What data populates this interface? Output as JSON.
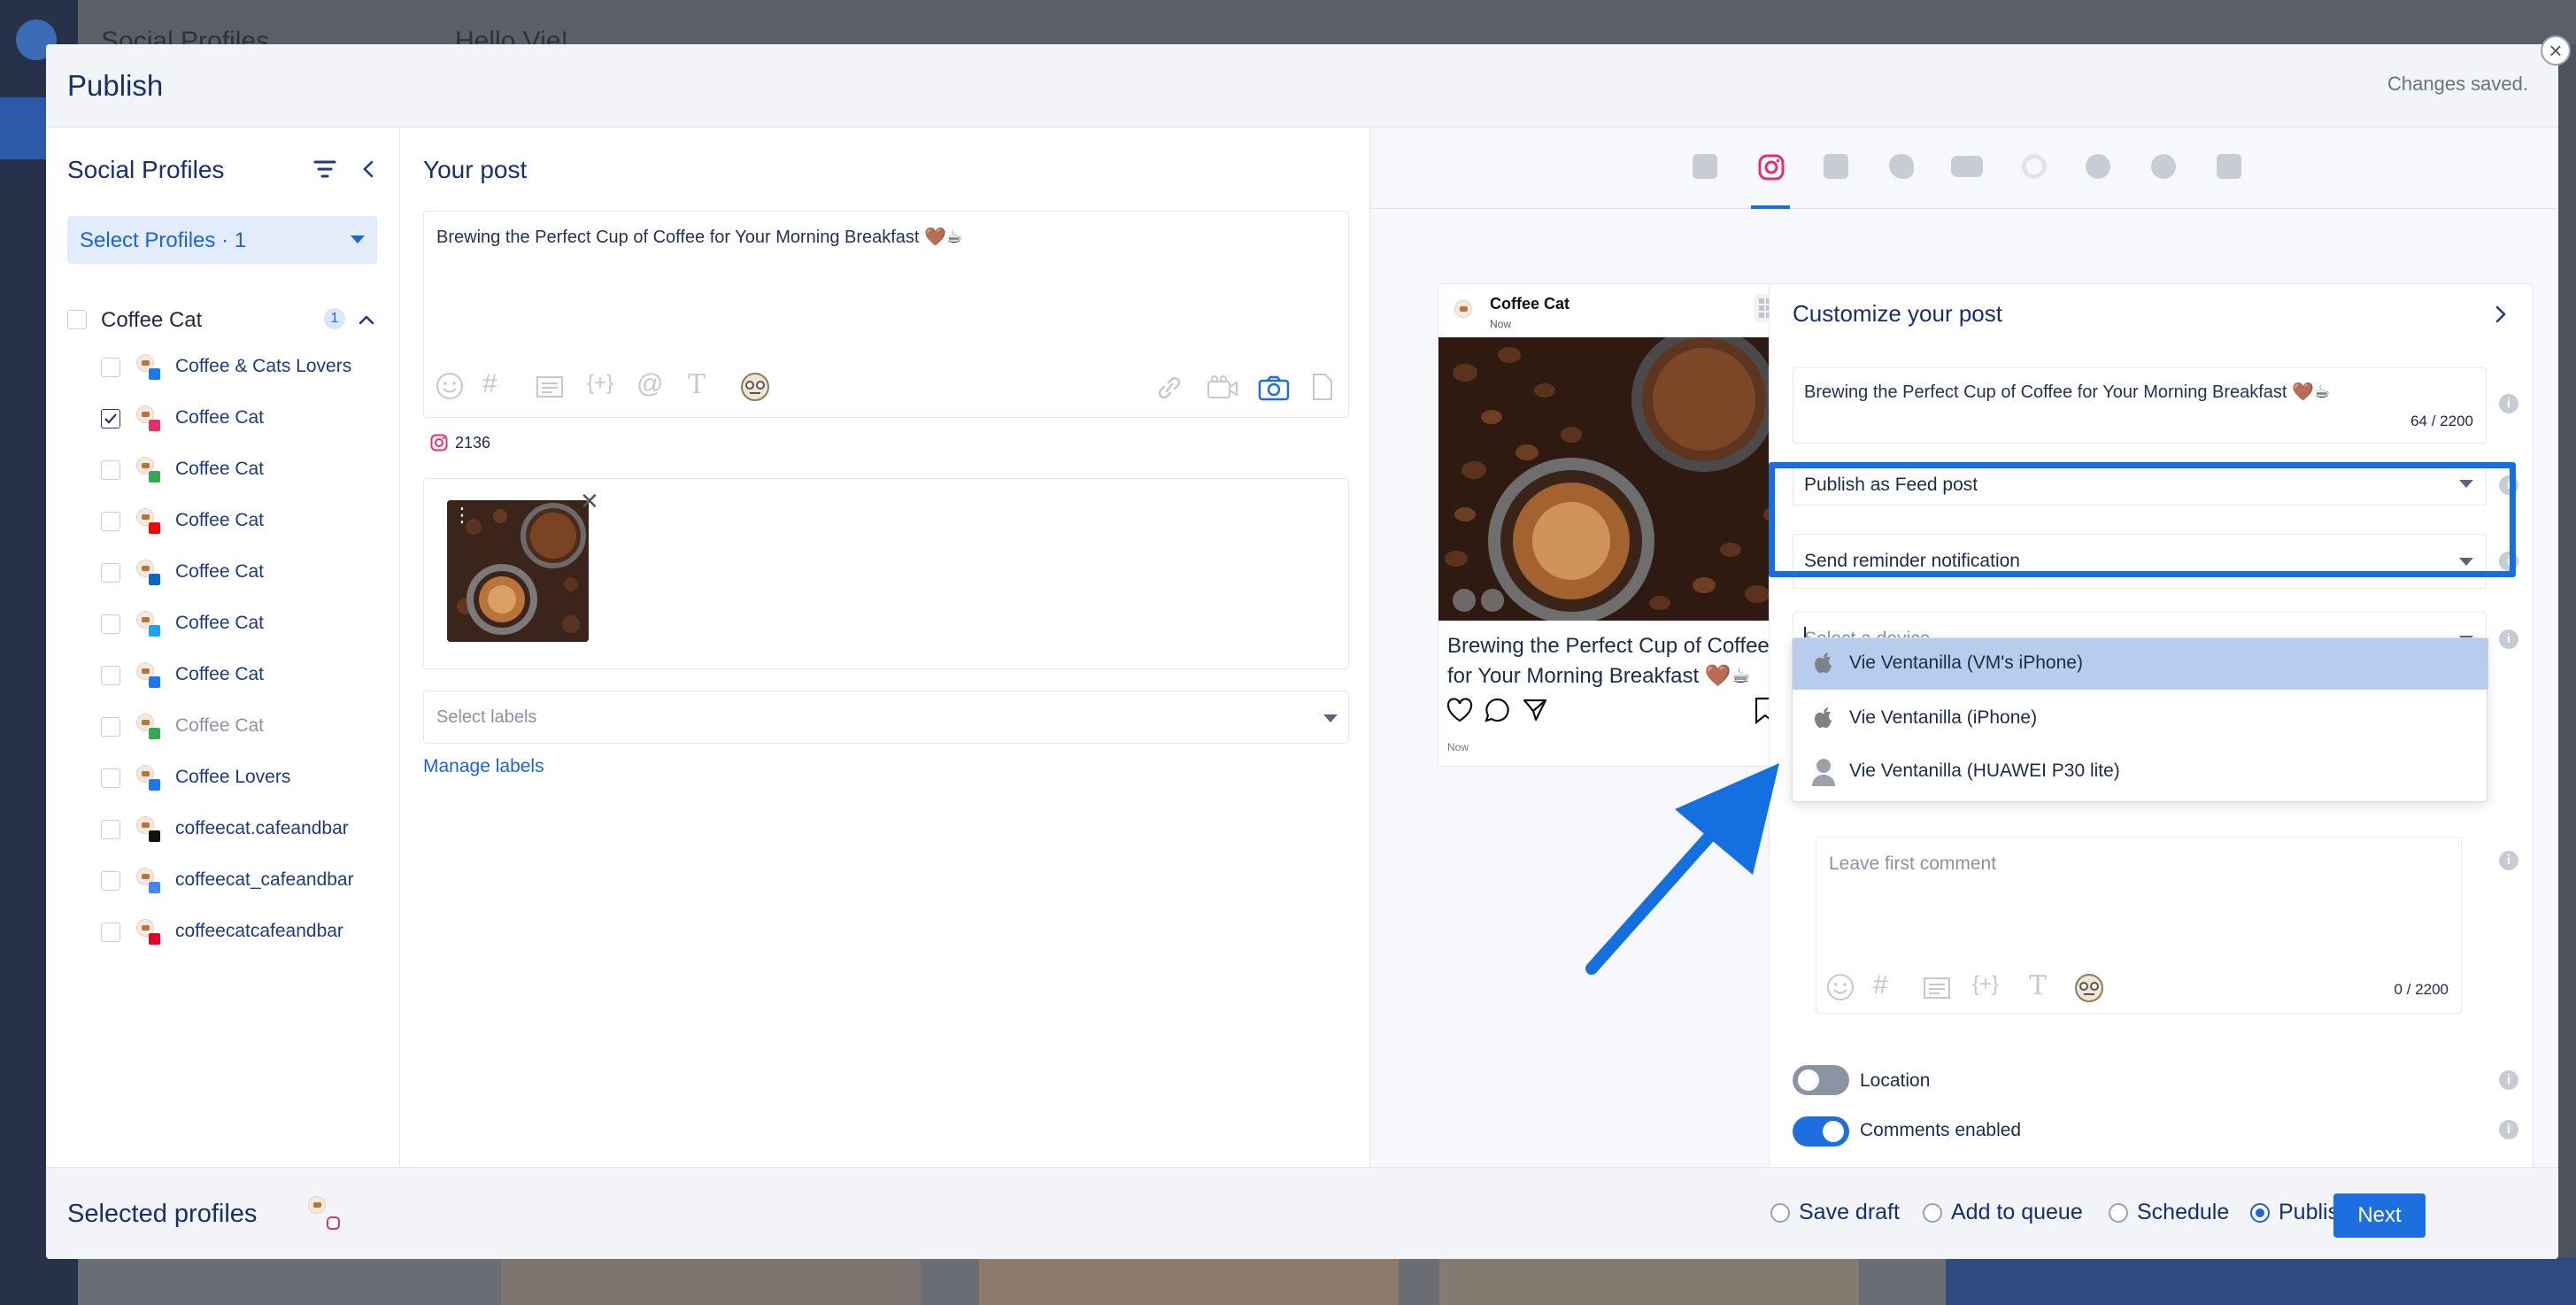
{
  "background": {
    "app_title": "Social Profiles",
    "greeting": "Hello Vie!"
  },
  "modal": {
    "title": "Publish",
    "status": "Changes saved.",
    "close": "×"
  },
  "left": {
    "title": "Social Profiles",
    "select_profiles": "Select Profiles · 1",
    "group": {
      "name": "Coffee Cat",
      "count": "1"
    },
    "profiles": [
      {
        "label": "Coffee & Cats Lovers",
        "network": "facebook",
        "checked": false
      },
      {
        "label": "Coffee Cat",
        "network": "instagram",
        "checked": true
      },
      {
        "label": "Coffee Cat",
        "network": "google",
        "checked": false
      },
      {
        "label": "Coffee Cat",
        "network": "youtube",
        "checked": false
      },
      {
        "label": "Coffee Cat",
        "network": "linkedin",
        "checked": false
      },
      {
        "label": "Coffee Cat",
        "network": "twitter",
        "checked": false
      },
      {
        "label": "Coffee Cat",
        "network": "facebook",
        "checked": false
      },
      {
        "label": "Coffee Cat",
        "network": "google",
        "checked": false,
        "dimmed": true
      },
      {
        "label": "Coffee Lovers",
        "network": "facebook",
        "checked": false
      },
      {
        "label": "coffeecat.cafeandbar",
        "network": "tiktok",
        "checked": false
      },
      {
        "label": "coffeecat_cafeandbar",
        "network": "google-business",
        "checked": false
      },
      {
        "label": "coffeecatcafeandbar",
        "network": "pinterest",
        "checked": false
      }
    ]
  },
  "center": {
    "title": "Your post",
    "post_text": "Brewing the Perfect Cup of Coffee for Your Morning Breakfast 🤎☕",
    "instagram_count": "2136",
    "labels_placeholder": "Select labels",
    "manage_labels": "Manage labels"
  },
  "preview": {
    "account": "Coffee Cat",
    "time": "Now",
    "caption": "Brewing the Perfect Cup of Coffee for Your Morning Breakfast 🤎☕",
    "footer_time": "Now"
  },
  "customize": {
    "title": "Customize your post",
    "text": "Brewing the Perfect Cup of Coffee for Your Morning Breakfast 🤎☕",
    "counter": "64 / 2200",
    "publish_type": "Publish as Feed post",
    "reminder": "Send reminder notification",
    "device_placeholder": "Select a device",
    "devices": [
      "Vie Ventanilla (VM's iPhone)",
      "Vie Ventanilla (iPhone)",
      "Vie Ventanilla (HUAWEI P30 lite)"
    ],
    "first_comment_placeholder": "Leave first comment",
    "comment_counter": "0 / 2200",
    "location_label": "Location",
    "location_on": false,
    "comments_label": "Comments enabled",
    "comments_on": true
  },
  "footer": {
    "selected_profiles": "Selected profiles",
    "options": [
      "Save draft",
      "Add to queue",
      "Schedule",
      "Publish now"
    ],
    "selected_option": "Publish now",
    "next": "Next"
  },
  "colors": {
    "accent": "#1d6fe0",
    "highlight": "#1470e0",
    "instagram": "#e1306c",
    "title": "#16306e"
  }
}
